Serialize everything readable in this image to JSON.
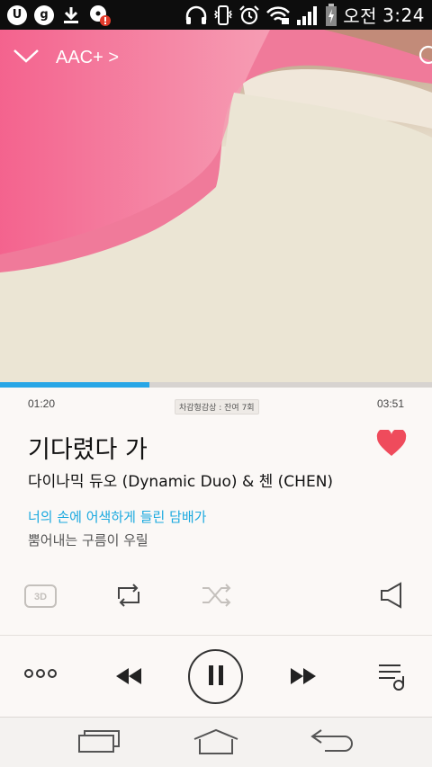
{
  "status_bar": {
    "app_icons": [
      "u-plus-icon",
      "g-icon",
      "download-icon",
      "disc-alert-icon"
    ],
    "g_label": "g",
    "u_label": "U",
    "time_prefix": "오전",
    "time": "3:24"
  },
  "header": {
    "codec": "AAC+ >"
  },
  "player": {
    "current_time": "01:20",
    "total_time": "03:51",
    "progress": 0.346,
    "listen_badge": "차감형감상 : 잔여 7회",
    "song_title": "기다렸다 가",
    "artist": "다이나믹 듀오 (Dynamic Duo) & 첸 (CHEN)",
    "lyric_current": "너의 손에 어색하게 들린 담배가",
    "lyric_next": "뿜어내는 구름이 우릴",
    "liked": true,
    "mode_3d_label": "3D"
  },
  "colors": {
    "accent": "#28a6e6",
    "lyric_highlight": "#1aa9df",
    "heart": "#ef4b5c"
  }
}
